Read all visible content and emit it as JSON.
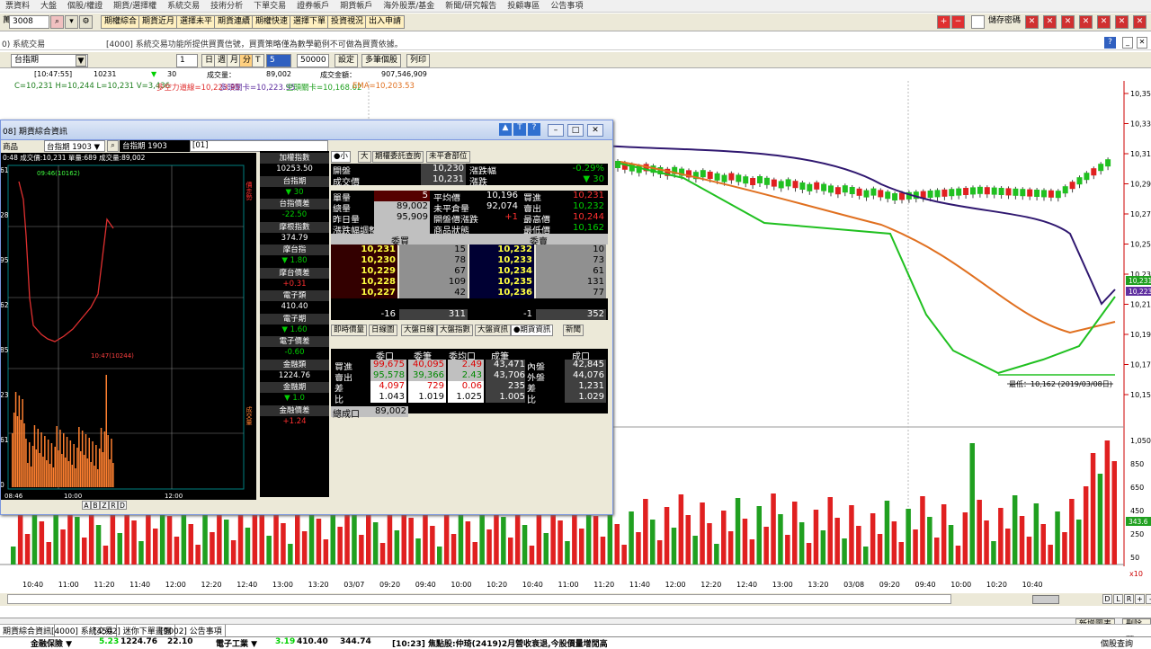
{
  "menu": [
    "票資料",
    "大盤",
    "個股/權證",
    "期貨/選擇權",
    "系統交易",
    "技術分析",
    "下單交易",
    "證券帳戶",
    "期貨帳戶",
    "海外股票/基金",
    "新聞/研究報告",
    "投顧專區",
    "公告事項"
  ],
  "toolbar": {
    "prefix": "萬",
    "code": "3008",
    "buttons": [
      "期權綜合",
      "期貨近月",
      "選擇未平",
      "期貨連續",
      "期權快速",
      "選擇下單",
      "投資視況",
      "出入申請"
    ],
    "save_pw": "儲存密碼"
  },
  "notice": {
    "left": "0) 系統交易",
    "text": "[4000] 系統交易功能所提供買賣信號，買賣策略僅為數學範例不可做為買賣依據。"
  },
  "opts": {
    "symbol": "台指期",
    "period_num": "1",
    "d": "日",
    "w": "週",
    "m": "月",
    "mins": "分",
    "t": "T",
    "sel": "5",
    "count": "50000",
    "setting": "設定",
    "multi": "多筆個股",
    "print": "列印"
  },
  "tickline": {
    "time": "[10:47:55]",
    "price": "10231",
    "arrow": "▼",
    "chg": "30",
    "vol_label": "成交量：",
    "vol": "89,002",
    "amt_label": "成交金額：",
    "amt": "907,546,909"
  },
  "indicator": {
    "ohlc": "C=10,231 H=10,244 L=10,231 V=3,436",
    "l1": "多空力道線=10,223.95",
    "l2": "多頭關卡=10,223.95",
    "l3": "空頭關卡=10,168.02",
    "l4": "EMA=10,203.53"
  },
  "yaxis": [
    "10,355",
    "10,335",
    "10,315",
    "10,295",
    "10,275",
    "10,255",
    "10,235",
    "10,215",
    "10,195",
    "10,175",
    "10,155"
  ],
  "vaxis": [
    "1,050",
    "850",
    "650",
    "450",
    "250",
    "50"
  ],
  "price_tags": {
    "a": "10,231",
    "b": "10,223",
    "c": "343.6"
  },
  "low_note": "最低：10,162 (2019/03/08日)",
  "xlabels": [
    "10:40",
    "11:00",
    "11:20",
    "11:40",
    "12:00",
    "12:20",
    "12:40",
    "13:00",
    "13:20",
    "03/07",
    "09:20",
    "09:40",
    "10:00",
    "10:20",
    "10:40",
    "11:00",
    "11:20",
    "11:40",
    "12:00",
    "12:20",
    "12:40",
    "13:00",
    "13:20",
    "03/08",
    "09:20",
    "09:40",
    "10:00",
    "10:20",
    "10:40"
  ],
  "lower_tags": [
    "D",
    "L",
    "R",
    "+",
    "-"
  ],
  "buttons_bottom": {
    "add": "新增圖表",
    "del": "刪除圖"
  },
  "tasks": [
    "期貨綜合資訊",
    "[4000] 系統交易",
    "[4502] 迷你下單畫面",
    "[9002] 公告事項"
  ],
  "ticker": {
    "left": "金融保險 ▼",
    "v1": "5.23",
    "v2": "1224.76",
    "v3": "22.10",
    "mid": "電子工業 ▼",
    "m1": "3.19",
    "m2": "410.40",
    "m3": "344.74",
    "news": "[10:23] 焦點股:仲琦(2419)2月營收衰退,今股價量增閒高",
    "right": "個股查詢"
  },
  "dlg": {
    "title": "08] 期貨綜合資訊",
    "prod": "商品",
    "sym": "台指期",
    "month": "1903",
    "name": "台指期 1903",
    "code": "[01]",
    "mini_hdr": "0:48 成交價:10,231 單量:689 成交量:89,002",
    "mini_labels": {
      "hi": "09:46(10162)",
      "lo": "10:47(10244)",
      "t1": "08:46",
      "t2": "10:00",
      "t3": "12:00"
    },
    "mini_y": [
      "61",
      "28",
      "95",
      "62",
      "85",
      "23",
      "61",
      "0"
    ],
    "mini_side1": "價走勢",
    "mini_side2": "成交量",
    "mini_btns": [
      "A",
      "B",
      "Z",
      "R",
      "D"
    ],
    "midcol": [
      {
        "l": "加權指數",
        "v": "10253.50",
        "c": "wht"
      },
      {
        "l": "台指期",
        "v": "▼ 30",
        "c": "grn"
      },
      {
        "l": "台指價差",
        "v": "-22.50",
        "c": "grn"
      },
      {
        "l": "摩根指數",
        "v": "374.79",
        "c": "wht"
      },
      {
        "l": "摩台指",
        "v": "▼ 1.80",
        "c": "grn"
      },
      {
        "l": "摩台價差",
        "v": "+0.31",
        "c": "red"
      },
      {
        "l": "電子類",
        "v": "410.40",
        "c": "wht"
      },
      {
        "l": "電子期",
        "v": "▼ 1.60",
        "c": "grn"
      },
      {
        "l": "電子價差",
        "v": "-0.60",
        "c": "grn"
      },
      {
        "l": "金融類",
        "v": "1224.76",
        "c": "wht"
      },
      {
        "l": "金融期",
        "v": "▼ 1.0",
        "c": "grn"
      },
      {
        "l": "金融價差",
        "v": "+1.24",
        "c": "red"
      }
    ],
    "qtabs": [
      "●小",
      "大",
      "期權委託查詢",
      "未平倉部位"
    ],
    "q1": [
      [
        "開盤",
        "10,230",
        "漲跌幅",
        "-0.29%"
      ],
      [
        "成交價",
        "10,231",
        "漲跌",
        "▼ 30"
      ]
    ],
    "q2": [
      [
        "單量",
        "5",
        "平均價",
        "10,196",
        "買進",
        "10,231"
      ],
      [
        "總量",
        "89,002",
        "未平倉量",
        "92,074",
        "賣出",
        "10,232"
      ],
      [
        "昨日量",
        "95,909",
        "開盤價漲跌",
        "+1",
        "最高價",
        "10,244"
      ],
      [
        "漲跌幅調整",
        "",
        "商品狀態",
        "",
        "最低價",
        "10,162"
      ]
    ],
    "bidask_hdr": [
      "委買",
      "委賣"
    ],
    "bidask": [
      [
        "10,231",
        "15",
        "10,232",
        "10"
      ],
      [
        "10,230",
        "78",
        "10,233",
        "73"
      ],
      [
        "10,229",
        "67",
        "10,234",
        "61"
      ],
      [
        "10,228",
        "109",
        "10,235",
        "131"
      ],
      [
        "10,227",
        "42",
        "10,236",
        "77"
      ]
    ],
    "bidask_tot": [
      "-16",
      "311",
      "-1",
      "352"
    ],
    "btabs": [
      "即時價量",
      "日線圖",
      "大盤日線",
      "大盤指數",
      "大盤資訊",
      "●期貨資訊",
      "新聞"
    ],
    "stat_hdr": [
      "委口",
      "委筆",
      "委均口",
      "成筆",
      "成口"
    ],
    "stat": [
      [
        "買進",
        "99,675",
        "40,095",
        "2.49",
        "43,471",
        "內盤",
        "42,845"
      ],
      [
        "賣出",
        "95,578",
        "39,366",
        "2.43",
        "43,706",
        "外盤",
        "44,076"
      ],
      [
        "差",
        "4,097",
        "729",
        "0.06",
        "235",
        "差",
        "1,231"
      ],
      [
        "比",
        "1.043",
        "1.019",
        "1.025",
        "1.005",
        "比",
        "1.029"
      ]
    ],
    "total_label": "總成口",
    "total": "89,002"
  }
}
